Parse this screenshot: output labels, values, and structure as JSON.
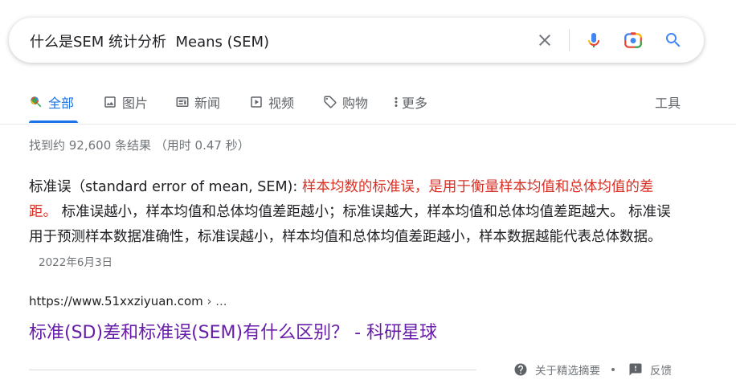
{
  "search": {
    "query": "什么是SEM 统计分析  Means (SEM)"
  },
  "tabs": [
    {
      "label": "全部",
      "icon": "search-icon",
      "active": true
    },
    {
      "label": "图片",
      "icon": "image-icon"
    },
    {
      "label": "新闻",
      "icon": "news-icon"
    },
    {
      "label": "视频",
      "icon": "video-icon"
    },
    {
      "label": "购物",
      "icon": "tag-icon"
    },
    {
      "label": "更多",
      "icon": "more-vert-icon"
    }
  ],
  "tools_label": "工具",
  "result_stats": "找到约 92,600 条结果 （用时 0.47 秒）",
  "snippet": {
    "prefix": "标准误（standard error of mean, SEM): ",
    "highlight": "样本均数的标准误，是用于衡量样本均值和总体均值的差距。",
    "body": " 标准误越小，样本均值和总体均值差距越小；标准误越大，样本均值和总体均值差距越大。 标准误用于预测样本数据准确性，标准误越小，样本均值和总体均值差距越小，样本数据越能代表总体数据。",
    "date": "2022年6月3日"
  },
  "result": {
    "cite_url": "https://www.51xxziyuan.com",
    "cite_more": " › ...",
    "title": "标准(SD)差和标准误(SEM)有什么区别？ - 科研星球"
  },
  "feedback": {
    "about_label": "关于精选摘要",
    "feedback_label": "反馈"
  },
  "colors": {
    "accent": "#1a73e8",
    "highlight": "#d93025",
    "visited_link": "#681da8"
  }
}
